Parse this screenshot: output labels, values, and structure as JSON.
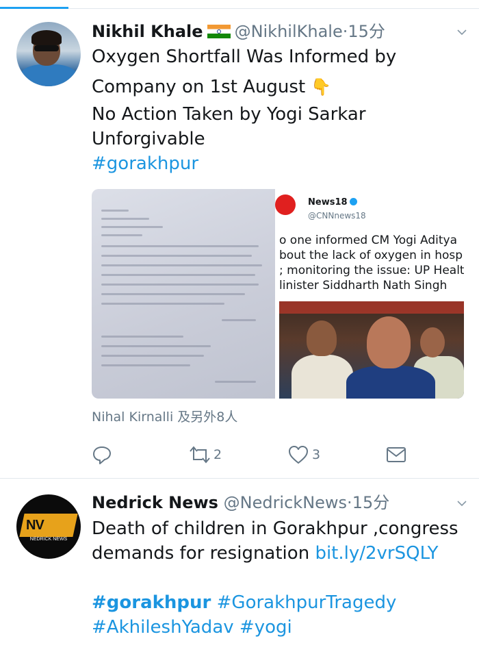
{
  "tweets": [
    {
      "name": "Nikhil Khale",
      "flag_icon": "india-flag-icon",
      "handle": "@NikhilKhale",
      "time": "15分",
      "lines": [
        "Oxygen Shortfall Was Informed by",
        "Company on 1st August",
        "No Action Taken by Yogi Sarkar",
        "Unforgivable"
      ],
      "pointer_emoji": "👇",
      "hashtag": "#gorakhpur",
      "embedded_card": {
        "name": "News18",
        "handle": "@CNNnews18",
        "lines": [
          "o one informed CM Yogi Aditya",
          "bout the lack of oxygen in hosp",
          "; monitoring the issue: UP Healt",
          "linister Siddharth Nath Singh"
        ]
      },
      "with_text": "Nihal Kirnalli 及另外8人",
      "actions": {
        "reply_count": "",
        "retweet_count": "2",
        "like_count": "3"
      }
    },
    {
      "name": "Nedrick News",
      "handle": "@NedrickNews",
      "time": "15分",
      "avatar_caption": "NEDRICK NEWS",
      "avatar_logo": "NV",
      "line1": "Death of children in Gorakhpur ,congress",
      "line2": "demands for resignation",
      "link": "bit.ly/2vrSQLY",
      "hashtags_line1": [
        "#gorakhpur",
        "#GorakhpurTragedy"
      ],
      "hashtags_line2": [
        "#AkhileshYadav",
        "#yogi"
      ]
    }
  ],
  "colors": {
    "link": "#1b95e0",
    "muted": "#657786",
    "text": "#14171a",
    "accent": "#1da1f2"
  }
}
